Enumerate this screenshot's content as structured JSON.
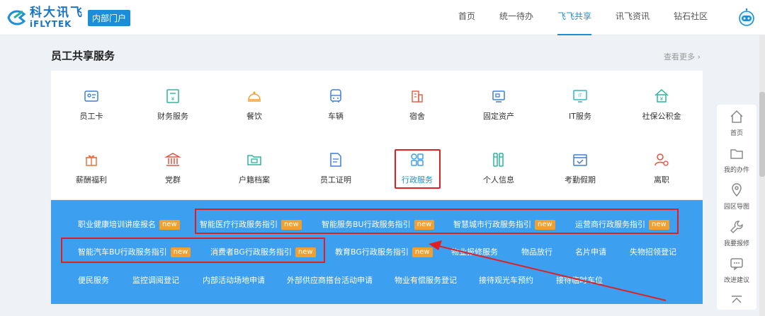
{
  "header": {
    "logo_cn": "科大讯飞",
    "logo_en": "iFLYTEK",
    "portal_badge": "内部门户",
    "nav": [
      "首页",
      "统一待办",
      "飞飞共享",
      "讯飞资讯",
      "钻石社区"
    ],
    "active_nav": "飞飞共享"
  },
  "section": {
    "title": "员工共享服务",
    "see_more": "查看更多 ›"
  },
  "services": [
    {
      "label": "员工卡",
      "icon": "id-card-icon"
    },
    {
      "label": "财务服务",
      "icon": "finance-icon"
    },
    {
      "label": "餐饮",
      "icon": "dining-bell-icon"
    },
    {
      "label": "车辆",
      "icon": "bus-icon"
    },
    {
      "label": "宿舍",
      "icon": "building-icon"
    },
    {
      "label": "固定资产",
      "icon": "asset-icon"
    },
    {
      "label": "IT服务",
      "icon": "it-monitor-icon"
    },
    {
      "label": "社保公积金",
      "icon": "house-fund-icon"
    },
    {
      "label": "薪酬福利",
      "icon": "gift-icon"
    },
    {
      "label": "党群",
      "icon": "party-building-icon"
    },
    {
      "label": "户籍档案",
      "icon": "archive-folder-icon"
    },
    {
      "label": "员工证明",
      "icon": "document-icon"
    },
    {
      "label": "行政服务",
      "icon": "grid-icon"
    },
    {
      "label": "个人信息",
      "icon": "profile-icon"
    },
    {
      "label": "考勤假期",
      "icon": "calendar-check-icon"
    },
    {
      "label": "离职",
      "icon": "user-leave-icon"
    }
  ],
  "active_service": "行政服务",
  "admin_links": {
    "new_badge": "new",
    "row1": [
      {
        "label": "职业健康培训讲座报名",
        "new": true
      },
      {
        "label": "智能医疗行政服务指引",
        "new": true
      },
      {
        "label": "智能服务BU行政服务指引",
        "new": true
      },
      {
        "label": "智慧城市行政服务指引",
        "new": true
      },
      {
        "label": "运营商行政服务指引",
        "new": true
      }
    ],
    "row2": [
      {
        "label": "智能汽车BU行政服务指引",
        "new": true
      },
      {
        "label": "消费者BG行政服务指引",
        "new": true
      },
      {
        "label": "教育BG行政服务指引",
        "new": true
      },
      {
        "label": "物业报修服务",
        "new": false
      },
      {
        "label": "物品放行",
        "new": false
      },
      {
        "label": "名片申请",
        "new": false
      },
      {
        "label": "失物招领登记",
        "new": false
      }
    ],
    "row3": [
      {
        "label": "便民服务",
        "new": false
      },
      {
        "label": "监控调阅登记",
        "new": false
      },
      {
        "label": "内部活动场地申请",
        "new": false
      },
      {
        "label": "外部供应商搭台活动申请",
        "new": false
      },
      {
        "label": "物业有偿服务登记",
        "new": false
      },
      {
        "label": "接待观光车预约",
        "new": false
      },
      {
        "label": "接待临时车位",
        "new": false
      }
    ]
  },
  "sidebar": [
    {
      "label": "首页",
      "icon": "home-icon"
    },
    {
      "label": "我的办件",
      "icon": "folder-icon"
    },
    {
      "label": "园区导图",
      "icon": "location-pin-icon"
    },
    {
      "label": "我要报修",
      "icon": "wrench-icon"
    },
    {
      "label": "改进建议",
      "icon": "chat-bubble-icon"
    }
  ],
  "colors": {
    "brand": "#1a8fd8",
    "panel_blue": "#3d9ff0",
    "new_badge": "#f0a030",
    "highlight_red": "#e02020"
  }
}
